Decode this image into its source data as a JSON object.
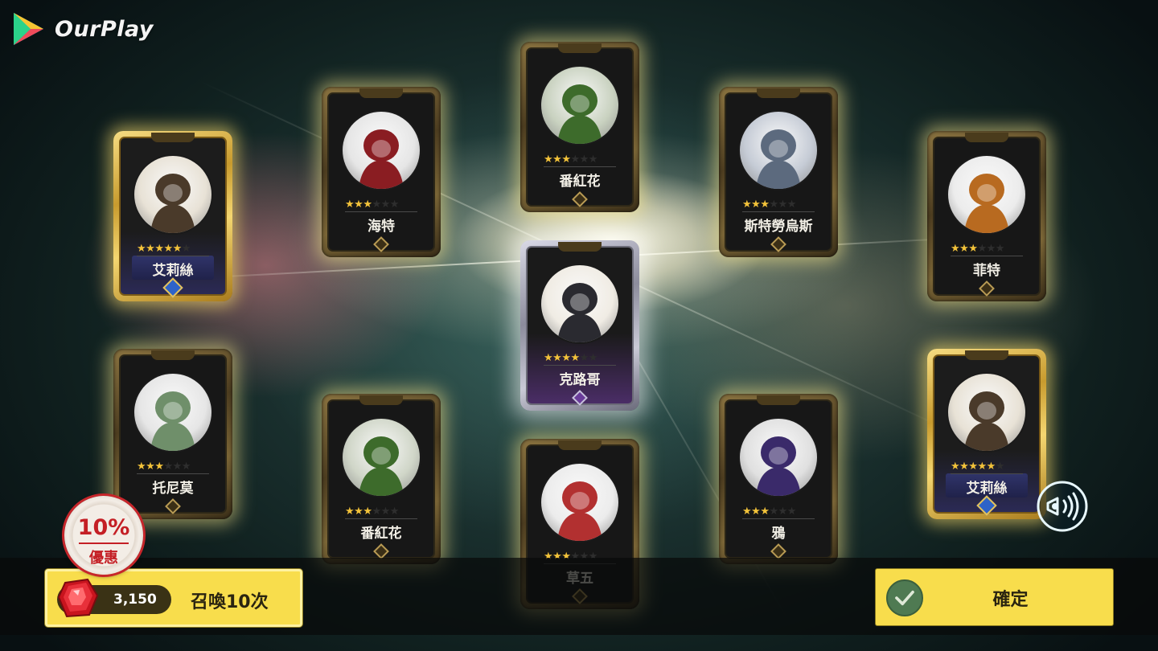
{
  "app": {
    "brand": "OurPlay"
  },
  "cards": [
    {
      "id": "alice-left",
      "name": "艾莉絲",
      "stars": 5,
      "rarity": "legend"
    },
    {
      "id": "hait",
      "name": "海特",
      "stars": 3,
      "rarity": "normal"
    },
    {
      "id": "crocus-top",
      "name": "番紅花",
      "stars": 3,
      "rarity": "normal"
    },
    {
      "id": "stratus",
      "name": "斯特勞烏斯",
      "stars": 3,
      "rarity": "normal"
    },
    {
      "id": "fait",
      "name": "菲特",
      "stars": 3,
      "rarity": "normal"
    },
    {
      "id": "karugo",
      "name": "克路哥",
      "stars": 4,
      "rarity": "epic"
    },
    {
      "id": "tonimo",
      "name": "托尼莫",
      "stars": 3,
      "rarity": "normal"
    },
    {
      "id": "crocus-bottom",
      "name": "番紅花",
      "stars": 3,
      "rarity": "normal"
    },
    {
      "id": "kusao",
      "name": "草五",
      "stars": 3,
      "rarity": "normal"
    },
    {
      "id": "crow",
      "name": "鴉",
      "stars": 3,
      "rarity": "normal"
    },
    {
      "id": "alice-right",
      "name": "艾莉絲",
      "stars": 5,
      "rarity": "legend"
    }
  ],
  "discount_badge": {
    "percent": "10%",
    "label": "優惠"
  },
  "summon_button": {
    "price": "3,150",
    "label": "召喚10次",
    "currency_icon": "ruby-icon"
  },
  "confirm_button": {
    "label": "確定",
    "icon": "check-icon"
  },
  "voice_button": {
    "icon": "voice-speaker-icon"
  },
  "colors": {
    "accent": "#f8dd4c",
    "discount": "#c41f25",
    "star": "#f3c33a"
  }
}
